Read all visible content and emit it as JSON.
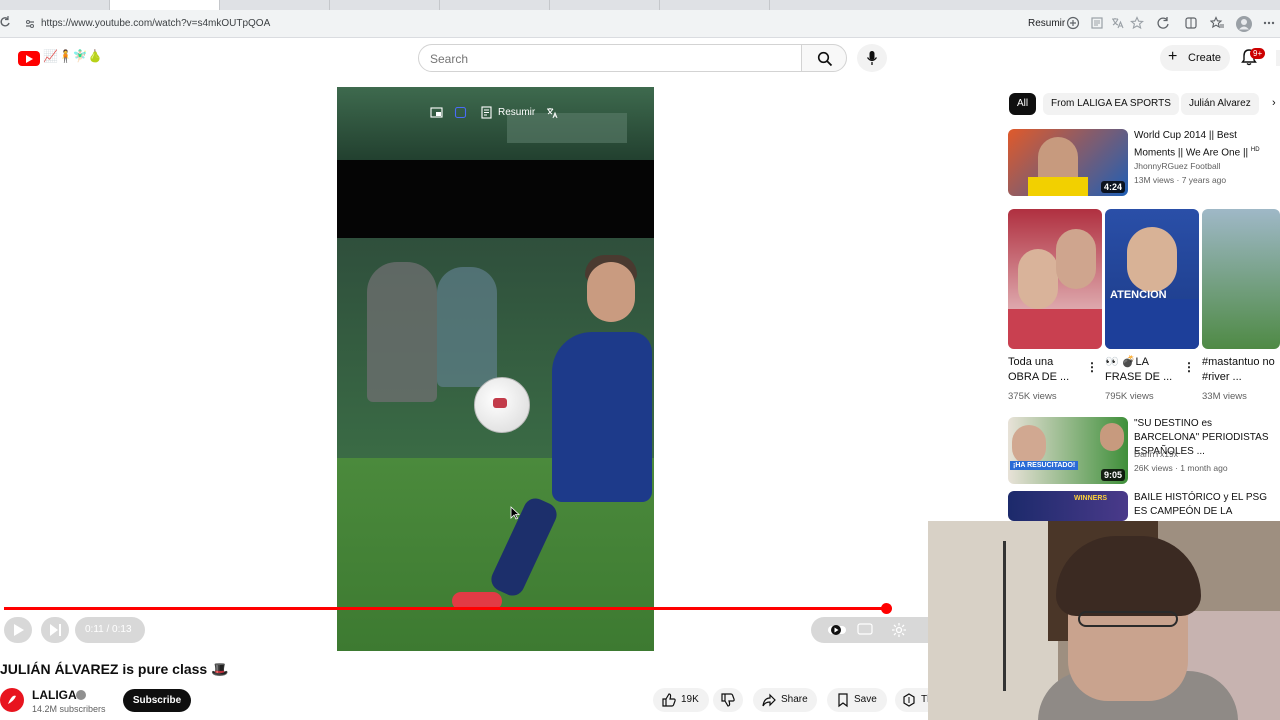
{
  "browser": {
    "url": "https://www.youtube.com/watch?v=s4mkOUTpQOA",
    "resumir_label": "Resumir"
  },
  "header": {
    "logo_emojis": "📈🧍🧚🏻‍♂️🍐",
    "search_placeholder": "Search",
    "create_label": "Create",
    "notifications_badge": "9+"
  },
  "player": {
    "overlay_label": "Resumir",
    "time": "0:11 / 0:13",
    "progress": 0.955
  },
  "video": {
    "title": "JULIÁN ÁLVAREZ is pure class 🎩",
    "channel": "LALIGA",
    "subscribers": "14.2M subscribers",
    "subscribe_label": "Subscribe",
    "likes": "19K",
    "share_label": "Share",
    "save_label": "Save",
    "extra_label": "Th"
  },
  "sidebar": {
    "chips": [
      "All",
      "From LALIGA EA SPORTS",
      "Julián Alvarez"
    ],
    "rec1": {
      "title": "World Cup 2014 || Best Moments || We Are One ||",
      "hd": "HD",
      "channel": "JhonnyRGuez Football",
      "meta": "13M views · 7 years ago",
      "duration": "4:24"
    },
    "shorts": [
      {
        "title": "Toda una OBRA DE ...",
        "views": "375K views"
      },
      {
        "title": "👀 💣LA FRASE DE ...",
        "views": "795K views"
      },
      {
        "title": "#mastantuo no #river ...",
        "views": "33M views"
      }
    ],
    "rec2": {
      "title": "\"SU DESTINO es BARCELONA\" PERIODISTAS ESPAÑOLES ...",
      "channel": "DannYx19x",
      "meta": "26K views · 1 month ago",
      "duration": "9:05",
      "thumb_text": "¡HA RESUCITADO!"
    },
    "rec3": {
      "title": "BAILE HISTÓRICO y EL PSG ES CAMPEÓN DE LA CHAMPION...",
      "thumb_text": "WINNERS"
    },
    "shorts_thumb_text": "ATENCION"
  },
  "colors": {
    "yt_red": "#ff0000",
    "dark": "#0f0f0f",
    "chip_bg": "#f2f2f2"
  }
}
